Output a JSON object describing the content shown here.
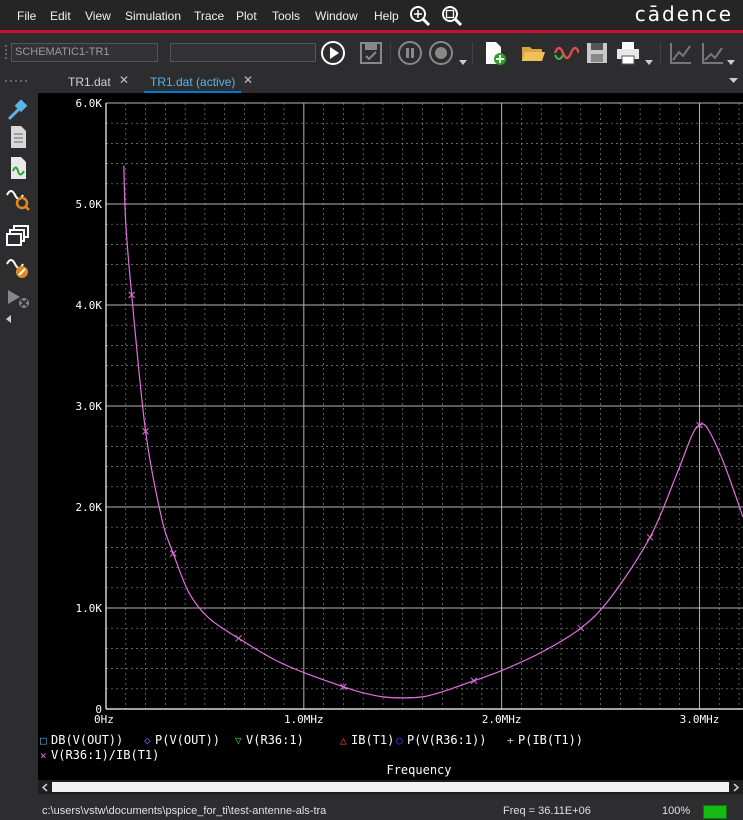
{
  "menu": {
    "items": [
      "File",
      "Edit",
      "View",
      "Simulation",
      "Trace",
      "Plot",
      "Tools",
      "Window",
      "Help"
    ],
    "brand": "cādence"
  },
  "toolbar": {
    "profile_value": "SCHEMATIC1-TR1",
    "second_field_value": ""
  },
  "tabs": [
    {
      "label": "TR1.dat",
      "active": false
    },
    {
      "label": "TR1.dat (active)",
      "active": true
    }
  ],
  "plot": {
    "y_tick_labels": [
      "6.0K",
      "5.0K",
      "4.0K",
      "3.0K",
      "2.0K",
      "1.0K",
      "0"
    ],
    "x_tick_labels": [
      "0Hz",
      "1.0MHz",
      "2.0MHz",
      "3.0MHz"
    ],
    "xlabel": "Frequency",
    "legend": [
      {
        "marker": "□",
        "label": "DB(V(OUT))",
        "color": "#5ab4e6"
      },
      {
        "marker": "◇",
        "label": "P(V(OUT))",
        "color": "#4a6cff"
      },
      {
        "marker": "▽",
        "label": "V(R36:1)",
        "color": "#2fbf2f"
      },
      {
        "marker": "△",
        "label": "IB(T1)",
        "color": "#ff3b3b"
      },
      {
        "marker": "○",
        "label": "P(V(R36:1))",
        "color": "#3b3bff"
      },
      {
        "marker": "+",
        "label": "P(IB(T1))",
        "color": "#d0d0d0"
      },
      {
        "marker": "×",
        "label": "V(R36:1)/IB(T1)",
        "color": "#e070e0"
      }
    ],
    "trace_color": "#e070e0",
    "grid_color": "#b4b4b4"
  },
  "chart_data": {
    "type": "line",
    "xlabel": "Frequency",
    "ylabel": "",
    "xlim": [
      0,
      3.22
    ],
    "ylim": [
      0,
      6000
    ],
    "x_unit": "MHz",
    "series": [
      {
        "name": "V(R36:1)/IB(T1)",
        "x": [
          0.09,
          0.1,
          0.13,
          0.2,
          0.28,
          0.34,
          0.42,
          0.52,
          0.67,
          0.85,
          1.0,
          1.2,
          1.3,
          1.4,
          1.5,
          1.6,
          1.7,
          1.86,
          2.0,
          2.2,
          2.4,
          2.55,
          2.75,
          2.88,
          2.96,
          3.0,
          3.04,
          3.12,
          3.22
        ],
        "y": [
          5380,
          4800,
          4100,
          2750,
          1900,
          1540,
          1150,
          900,
          700,
          490,
          360,
          220,
          160,
          120,
          110,
          120,
          170,
          280,
          380,
          560,
          800,
          1100,
          1700,
          2300,
          2700,
          2810,
          2780,
          2450,
          1900
        ]
      }
    ],
    "grid": true,
    "legend_position": "bottom-left"
  },
  "status": {
    "path": "c:\\users\\vstw\\documents\\pspice_for_ti\\test-antenne-als-tra",
    "freq": "Freq =  36.11E+06",
    "zoom": "100%"
  }
}
